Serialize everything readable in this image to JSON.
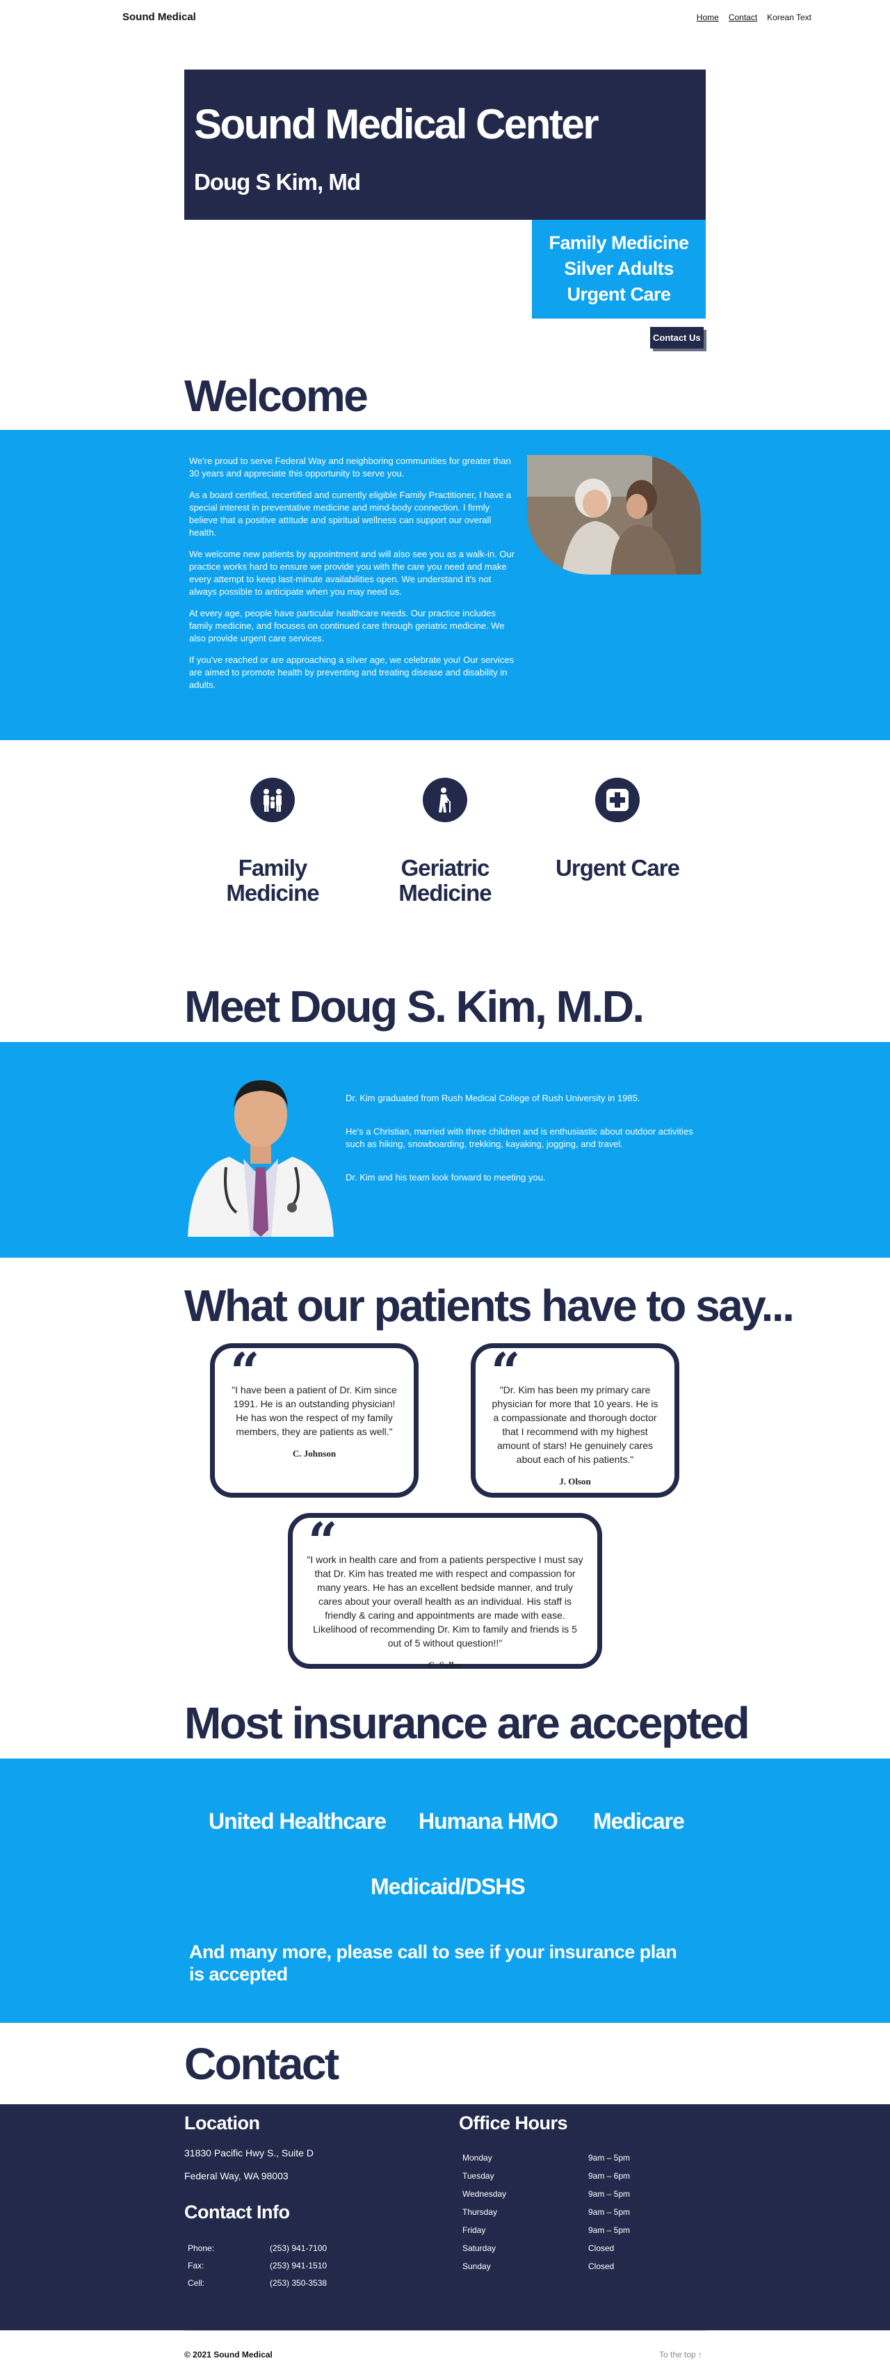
{
  "site": {
    "title": "Sound Medical"
  },
  "nav": {
    "home": "Home",
    "contact": "Contact",
    "korean": "Korean Text"
  },
  "hero": {
    "title": "Sound Medical Center",
    "subtitle": "Doug S Kim, Md",
    "services": [
      "Family Medicine",
      "Silver Adults",
      "Urgent Care"
    ],
    "cta": "Contact Us"
  },
  "welcome": {
    "heading": "Welcome",
    "paragraphs": [
      "We're proud to serve Federal Way and neighboring communities for greater than 30 years and appreciate this opportunity to serve you.",
      "As a board certified, recertified and currently eligible Family Practitioner, I have a special interest in preventative medicine and mind-body connection. I firmly believe that a positive attitude and spiritual wellness can support our overall health.",
      "We welcome new patients by appointment and will also see you as a walk-in. Our practice works hard to ensure we provide you with the care you need and make every attempt to keep last-minute availabilities open. We understand it's not always possible to anticipate when you may need us.",
      "At every age, people have particular healthcare needs. Our practice includes family medicine, and focuses on continued care through geriatric medicine. We also provide urgent care services.",
      "If you've reached or are approaching a silver age, we celebrate you! Our services are aimed to promote health by preventing and treating disease and disability in adults."
    ]
  },
  "services": [
    {
      "label": "Family Medicine",
      "icon": "family-icon"
    },
    {
      "label": "Geriatric Medicine",
      "icon": "elderly-person-icon"
    },
    {
      "label": "Urgent Care",
      "icon": "medical-cross-icon"
    }
  ],
  "meet": {
    "heading": "Meet Doug S. Kim, M.D.",
    "paragraphs": [
      "Dr. Kim graduated from Rush Medical College of Rush University in 1985.",
      "He's a Christian, married with three children and is enthusiastic about outdoor activities such as hiking, snowboarding, trekking, kayaking, jogging, and travel.",
      "Dr. Kim and his team look forward to meeting you."
    ]
  },
  "testimonials": {
    "heading": "What our patients have to say...",
    "items": [
      {
        "text": "\"I have been a patient of Dr. Kim since 1991. He is an outstanding physician! He has won the respect of my family members, they are patients as well.\"",
        "author": "C. Johnson"
      },
      {
        "text": "\"Dr. Kim has been my primary care physician for more that 10 years. He is a compassionate and thorough doctor that I recommend with my highest amount of stars! He genuinely cares about each of his patients.\"",
        "author": "J. Olson"
      },
      {
        "text": "\"I work in health care and from a patients perspective I must say that Dr. Kim has treated me with respect and compassion for many years. He has an excellent bedside manner, and truly cares about your overall health as an individual. His staff is friendly & caring and appointments are made with ease. Likelihood of recommending Dr. Kim to family and friends is 5 out of 5 without question!!\"",
        "author": "C. Sallee"
      }
    ]
  },
  "insurance": {
    "heading": "Most insurance are accepted",
    "plans": [
      "United Healthcare",
      "Humana HMO",
      "Medicare",
      "Medicaid/DSHS"
    ],
    "more": "And many more, please call to see if your insurance plan is accepted"
  },
  "contact": {
    "heading": "Contact",
    "location_heading": "Location",
    "address_line1": "31830 Pacific Hwy S., Suite D",
    "address_line2": "Federal Way, WA 98003",
    "info_heading": "Contact Info",
    "info": [
      {
        "label": "Phone:",
        "value": "(253) 941-7100"
      },
      {
        "label": "Fax:",
        "value": "(253) 941-1510"
      },
      {
        "label": "Cell:",
        "value": "(253) 350-3538"
      }
    ],
    "hours_heading": "Office Hours",
    "hours": [
      {
        "day": "Monday",
        "time": "9am – 5pm"
      },
      {
        "day": "Tuesday",
        "time": "9am – 6pm"
      },
      {
        "day": "Wednesday",
        "time": "9am – 5pm"
      },
      {
        "day": "Thursday",
        "time": "9am – 5pm"
      },
      {
        "day": "Friday",
        "time": "9am – 5pm"
      },
      {
        "day": "Saturday",
        "time": "Closed"
      },
      {
        "day": "Sunday",
        "time": "Closed"
      }
    ]
  },
  "footer": {
    "copyright": "© 2021 Sound Medical",
    "to_top": "To the top ↑"
  },
  "colors": {
    "navy": "#22294a",
    "blue": "#0ea2ef",
    "white": "#ffffff"
  }
}
